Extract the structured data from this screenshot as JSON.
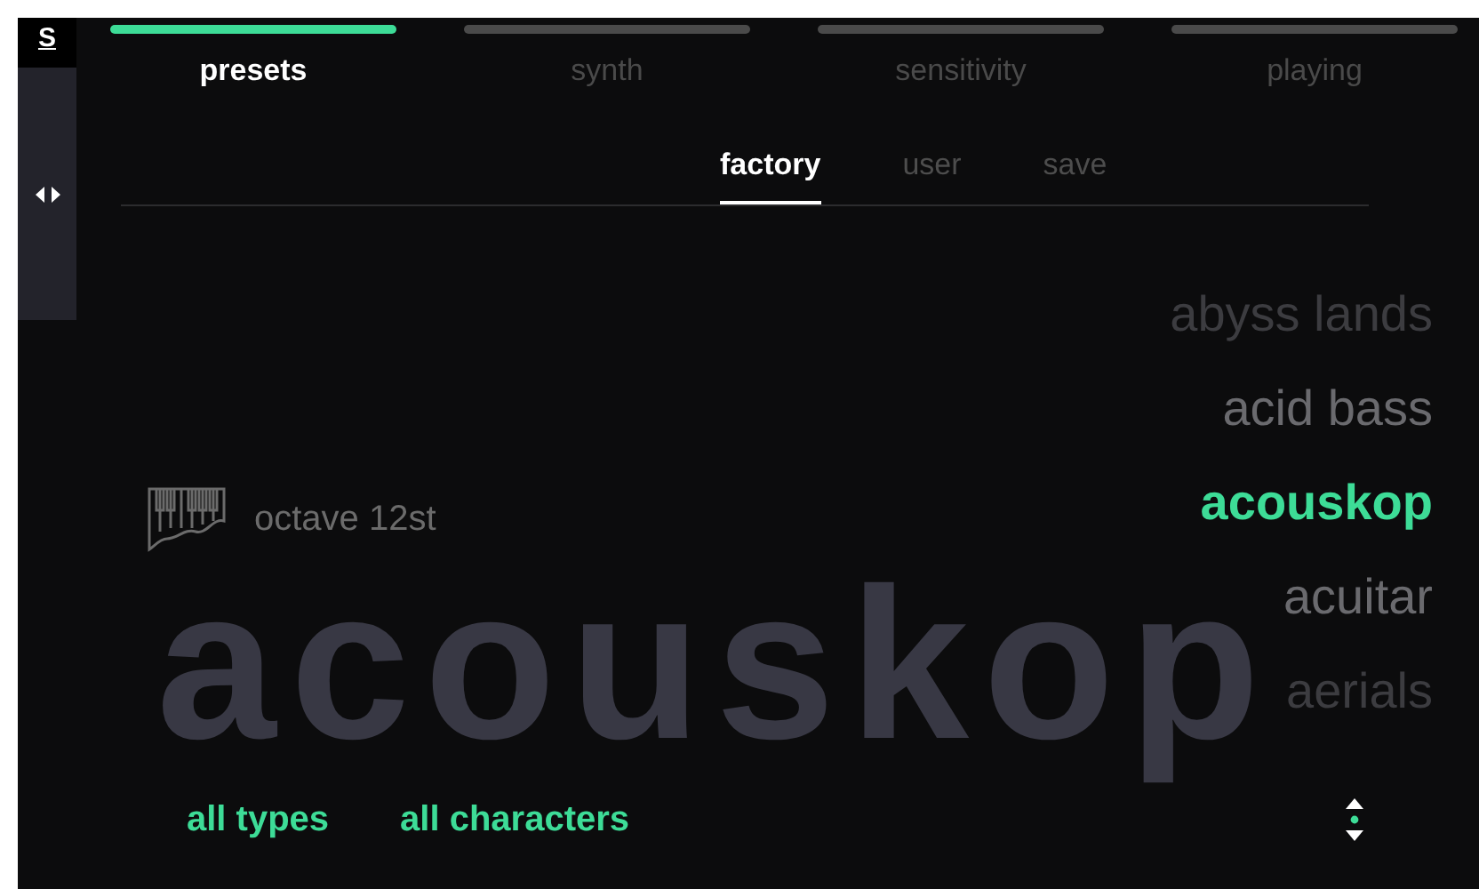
{
  "sidebar": {
    "logo": "S"
  },
  "tabs": [
    {
      "label": "presets",
      "selected": true
    },
    {
      "label": "synth",
      "selected": false
    },
    {
      "label": "sensitivity",
      "selected": false
    },
    {
      "label": "playing",
      "selected": false
    }
  ],
  "subtabs": [
    {
      "label": "factory",
      "selected": true
    },
    {
      "label": "user",
      "selected": false
    },
    {
      "label": "save",
      "selected": false
    }
  ],
  "current_preset": {
    "name": "acouskop",
    "tuning": "octave 12st"
  },
  "presets": [
    {
      "name": "abyss lands",
      "selected": false
    },
    {
      "name": "acid bass",
      "selected": false
    },
    {
      "name": "acouskop",
      "selected": true
    },
    {
      "name": "acuitar",
      "selected": false
    },
    {
      "name": "aerials",
      "selected": false
    }
  ],
  "filters": [
    {
      "label": "all types"
    },
    {
      "label": "all characters"
    }
  ]
}
